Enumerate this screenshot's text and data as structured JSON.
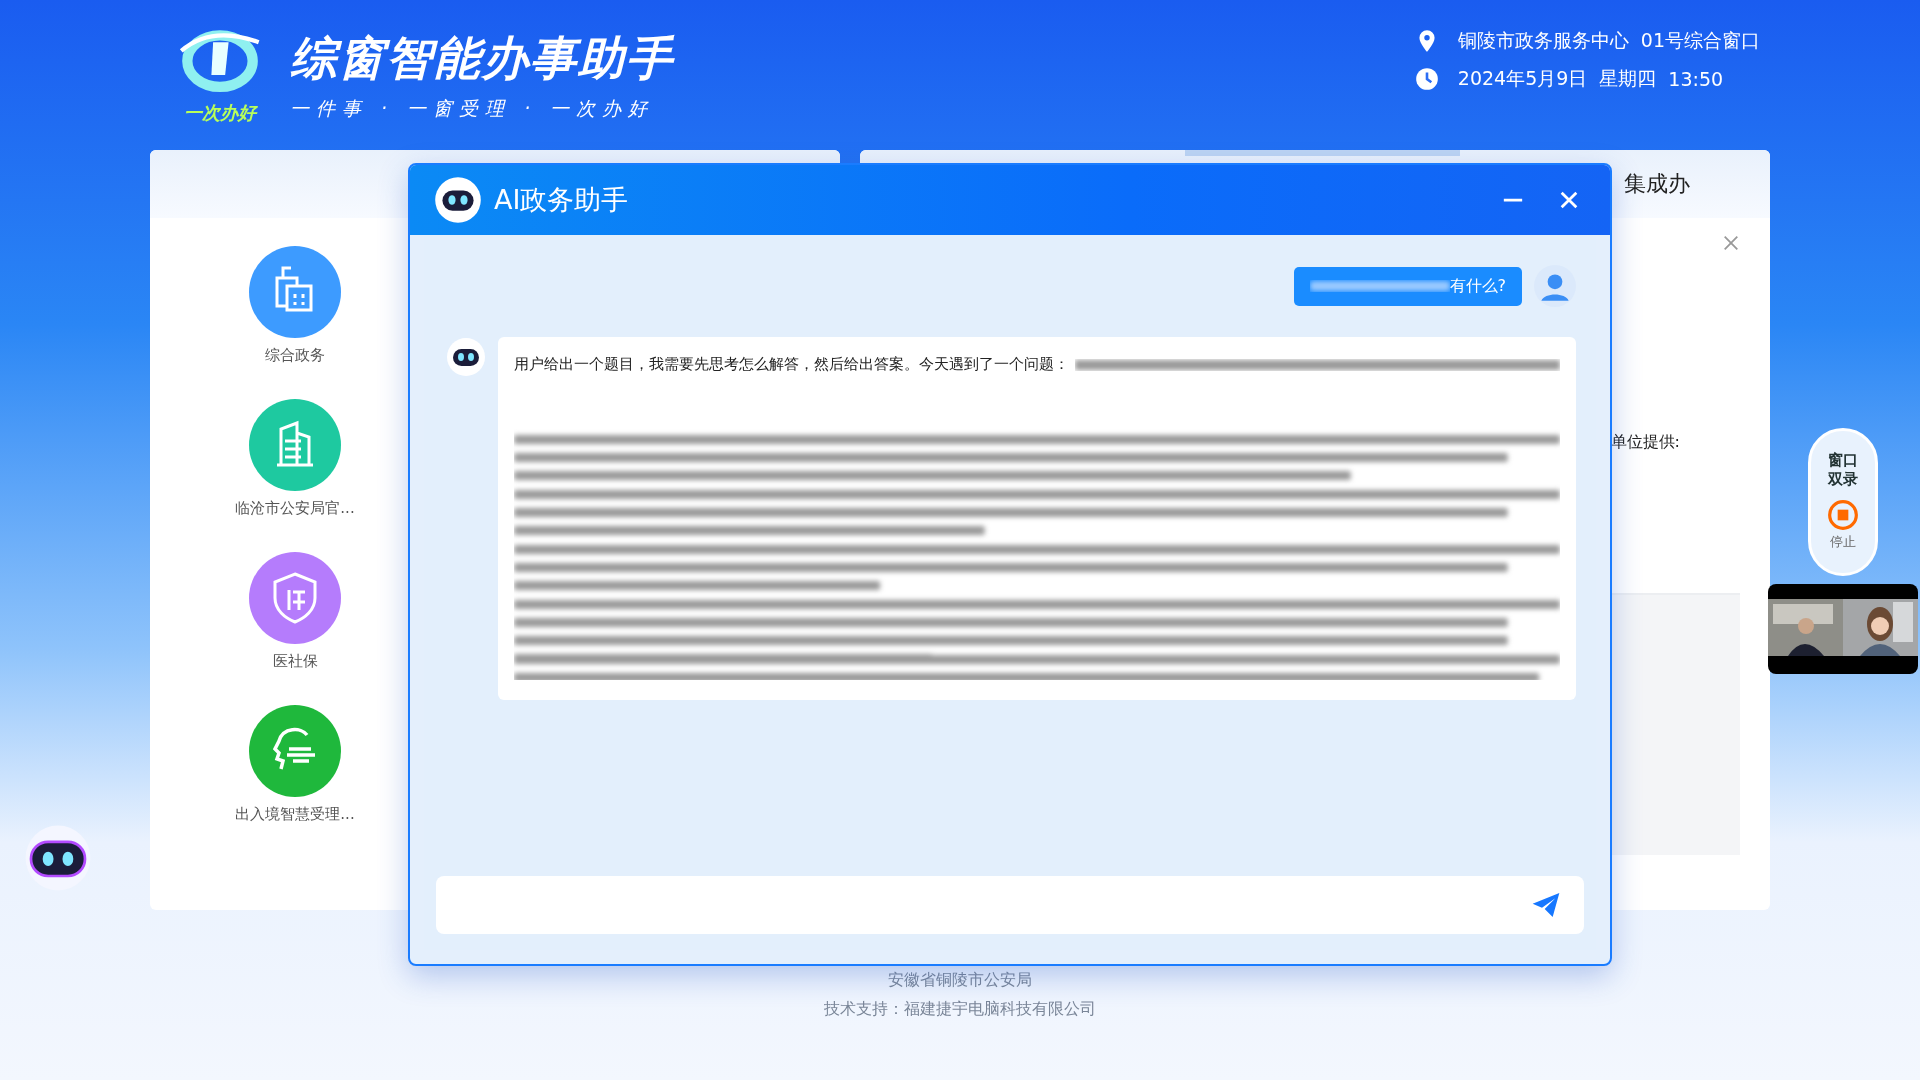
{
  "header": {
    "logo_caption": "一次办好",
    "title": "综窗智能办事助手",
    "slogan": "一件事 · 一窗受理 · 一次办好",
    "location": "铜陵市政务服务中心",
    "window": "01号综合窗口",
    "date": "2024年5月9日",
    "weekday": "星期四",
    "time": "13:50"
  },
  "sidebar": {
    "items": [
      {
        "label": "综合政务",
        "color": "#3d9bff",
        "kind": "office"
      },
      {
        "label": "临沧市公安局官...",
        "color": "#1ec9a0",
        "kind": "building"
      },
      {
        "label": "医社保",
        "color": "#b57cfc",
        "kind": "shield"
      },
      {
        "label": "出入境智慧受理...",
        "color": "#1fb83c",
        "kind": "head"
      }
    ]
  },
  "right_panel": {
    "tab": "集成办",
    "note": "单位提供:"
  },
  "dialog": {
    "title": "AI政务助手",
    "messages": [
      {
        "kind": "user",
        "text": "有什么?"
      },
      {
        "kind": "assistant",
        "text": "用户给出一个题目，我需要先思考怎么解答，然后给出答案。今天遇到了一个问题："
      }
    ]
  },
  "record": {
    "label": "窗口双录",
    "stop": "停止"
  },
  "footer": [
    "安徽省铜陵市公安局",
    "技术支持：福建捷宇电脑科技有限公司"
  ]
}
